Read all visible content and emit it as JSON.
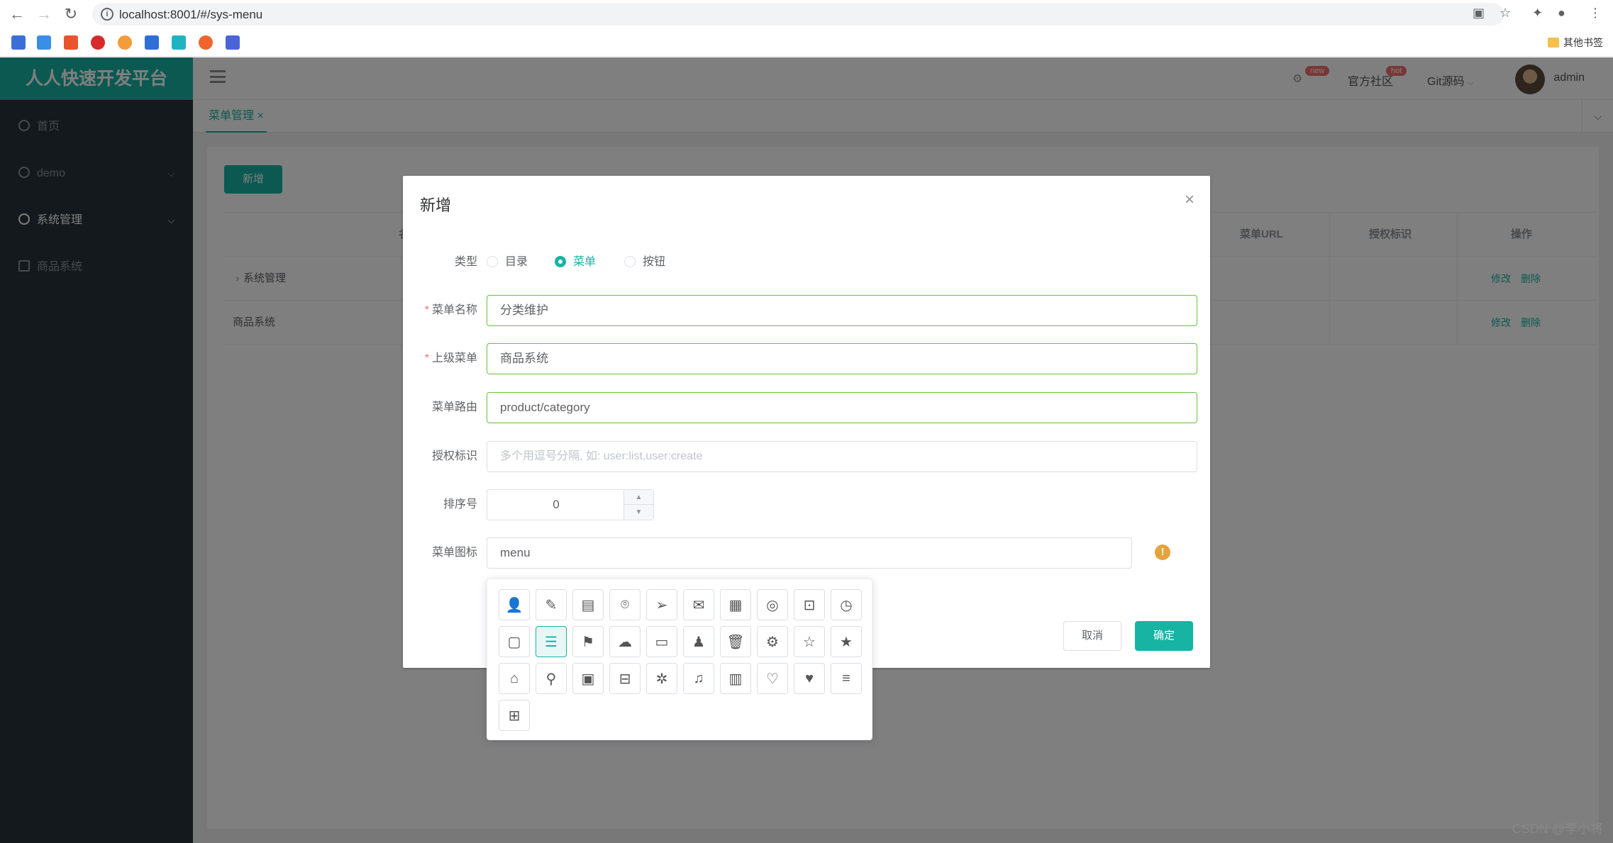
{
  "browser": {
    "url": "localhost:8001/#/sys-menu",
    "bookmark_other": "其他书签"
  },
  "sidebar": {
    "brand": "人人快速开发平台",
    "items": [
      {
        "label": "首页"
      },
      {
        "label": "demo"
      },
      {
        "label": "系统管理"
      },
      {
        "label": "商品系统"
      }
    ]
  },
  "header": {
    "links": [
      {
        "label": "官方社区",
        "badge": "hot"
      },
      {
        "label": "Git源码"
      }
    ],
    "settings_badge": "new",
    "user": "admin"
  },
  "tabs": [
    {
      "label": "菜单管理 ×"
    }
  ],
  "content": {
    "add_button": "新增",
    "table": {
      "columns": [
        "名称",
        "菜单URL",
        "授权标识",
        "操作"
      ],
      "rows": [
        {
          "name": "系统管理",
          "edit": "修改",
          "delete": "删除"
        },
        {
          "name": "商品系统",
          "edit": "修改",
          "delete": "删除"
        }
      ]
    }
  },
  "dialog": {
    "title": "新增",
    "type_label": "类型",
    "type_options": [
      "目录",
      "菜单",
      "按钮"
    ],
    "selected_type": "菜单",
    "fields": {
      "name": {
        "label": "菜单名称",
        "value": "分类维护"
      },
      "parent": {
        "label": "上级菜单",
        "value": "商品系统"
      },
      "route": {
        "label": "菜单路由",
        "value": "product/category"
      },
      "perms": {
        "label": "授权标识",
        "placeholder": "多个用逗号分隔, 如: user:list,user:create"
      },
      "order": {
        "label": "排序号",
        "value": "0"
      },
      "icon": {
        "label": "菜单图标",
        "value": "menu"
      }
    },
    "cancel": "取消",
    "confirm": "确定"
  },
  "icon_picker": {
    "icons": [
      {
        "name": "user-icon",
        "glyph": "👤"
      },
      {
        "name": "edit-icon",
        "glyph": "✎"
      },
      {
        "name": "log-icon",
        "glyph": "▤"
      },
      {
        "name": "location-icon",
        "glyph": "⌾"
      },
      {
        "name": "send-icon",
        "glyph": "➢"
      },
      {
        "name": "mail-icon",
        "glyph": "✉"
      },
      {
        "name": "news-icon",
        "glyph": "▦"
      },
      {
        "name": "admin-icon",
        "glyph": "◎"
      },
      {
        "name": "lock-icon",
        "glyph": "⊡"
      },
      {
        "name": "clock-icon",
        "glyph": "◷"
      },
      {
        "name": "document-icon",
        "glyph": "▢"
      },
      {
        "name": "menu-list-icon",
        "glyph": "☰"
      },
      {
        "name": "signpost-icon",
        "glyph": "⚑"
      },
      {
        "name": "cloud-upload-icon",
        "glyph": "☁"
      },
      {
        "name": "message-icon",
        "glyph": "▭"
      },
      {
        "name": "role-icon",
        "glyph": "♟"
      },
      {
        "name": "delete-icon",
        "glyph": "🗑"
      },
      {
        "name": "settings-icon",
        "glyph": "⚙"
      },
      {
        "name": "star-icon",
        "glyph": "☆"
      },
      {
        "name": "star-filled-icon",
        "glyph": "★"
      },
      {
        "name": "home-icon",
        "glyph": "⌂"
      },
      {
        "name": "search-icon",
        "glyph": "⚲"
      },
      {
        "name": "calendar-icon",
        "glyph": "▣"
      },
      {
        "name": "unlock-icon",
        "glyph": "⊟"
      },
      {
        "name": "gear-icon",
        "glyph": "✲"
      },
      {
        "name": "bell-icon",
        "glyph": "♫"
      },
      {
        "name": "chart-icon",
        "glyph": "▥"
      },
      {
        "name": "heart-icon",
        "glyph": "♡"
      },
      {
        "name": "heart-filled-icon",
        "glyph": "♥"
      },
      {
        "name": "lines-icon",
        "glyph": "≡"
      },
      {
        "name": "grid-icon",
        "glyph": "⊞"
      }
    ],
    "selected": "menu-list-icon"
  },
  "watermark": "CSDN @李小将",
  "colors": {
    "primary": "#17b3a3",
    "sidebar": "#263238",
    "success_border": "#67c23a",
    "danger": "#f56c6c",
    "warning": "#e6a23c"
  }
}
